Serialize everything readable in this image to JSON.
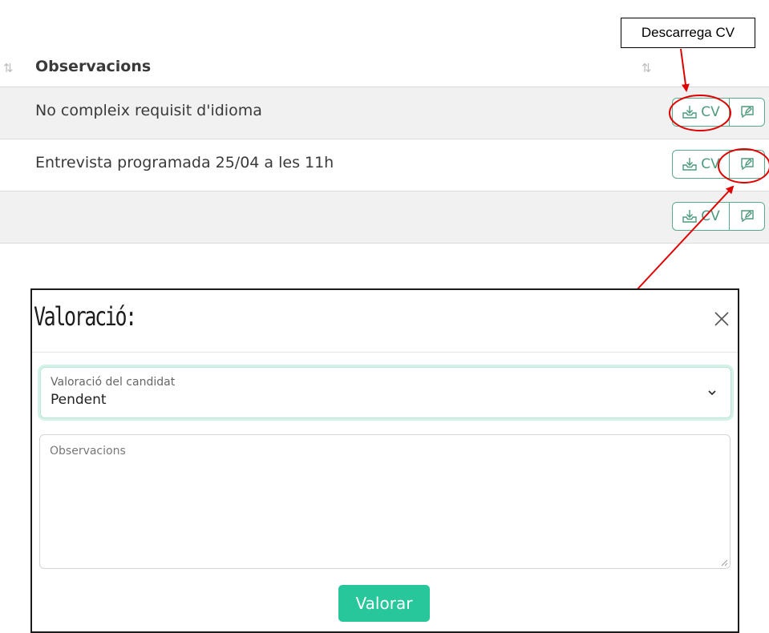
{
  "table": {
    "column_header": "Observacions",
    "sort_icon": "⇅",
    "rows": [
      {
        "observation": "No compleix requisit d'idioma",
        "cv_label": "CV"
      },
      {
        "observation": "Entrevista programada 25/04 a les 11h",
        "cv_label": "CV"
      },
      {
        "observation": "",
        "cv_label": "CV"
      }
    ]
  },
  "callout": {
    "text": "Descarrega CV"
  },
  "modal": {
    "title": "Valoració:",
    "select": {
      "label": "Valoració del candidat",
      "value": "Pendent"
    },
    "textarea": {
      "placeholder": "Observacions"
    },
    "submit_label": "Valorar"
  },
  "colors": {
    "accent": "#28c79b",
    "button_border": "#5aa98a",
    "annotation": "#e00000"
  }
}
